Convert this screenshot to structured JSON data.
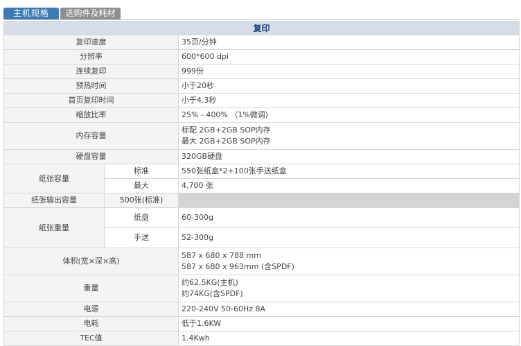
{
  "tabs": {
    "main": "主机规格",
    "options": "选购件及耗材"
  },
  "section_title": "复印",
  "rows": {
    "speed": {
      "label": "复印速度",
      "value": "35页/分钟"
    },
    "resolution": {
      "label": "分辨率",
      "value": "600*600 dpi"
    },
    "continuous": {
      "label": "连续复印",
      "value": "999份"
    },
    "warmup": {
      "label": "预热时间",
      "value": "小于20秒"
    },
    "first_copy": {
      "label": "首页复印时间",
      "value": "小于4.3秒"
    },
    "zoom": {
      "label": "缩放比率",
      "value": "25% - 400% （1%微调)"
    },
    "memory": {
      "label": "内存容量",
      "line1": "标配 2GB+2GB SOP内存",
      "line2": "最大 2GB+2GB SOP内存"
    },
    "hdd": {
      "label": "硬盘容量",
      "value": "320GB硬盘"
    },
    "paper_capacity": {
      "label": "纸张容量",
      "std_label": "标准",
      "std_value": "550张纸盒*2+100张手送纸盒",
      "max_label": "最大",
      "max_value": "4,700 张"
    },
    "output": {
      "label": "纸张输出容量",
      "value": "500张(标准)"
    },
    "paper_weight": {
      "label": "纸张重量",
      "tray_label": "纸盘",
      "tray_value": "60-300g",
      "bypass_label": "手送",
      "bypass_value": "52-300g"
    },
    "dimensions": {
      "label": "体积(宽×深×高)",
      "line1": "587 x 680 x 788 mm",
      "line2": "587 x 680 x 963mm (含SPDF)"
    },
    "weight": {
      "label": "重量",
      "line1": "约62.5KG(主机)",
      "line2": "约74KG(含SPDF)"
    },
    "power": {
      "label": "电源",
      "value": "220-240V 50-60Hz 8A"
    },
    "consumption": {
      "label": "电耗",
      "value": "低于1.6KW"
    },
    "tec": {
      "label": "TEC值",
      "value": "1.4Kwh"
    }
  }
}
